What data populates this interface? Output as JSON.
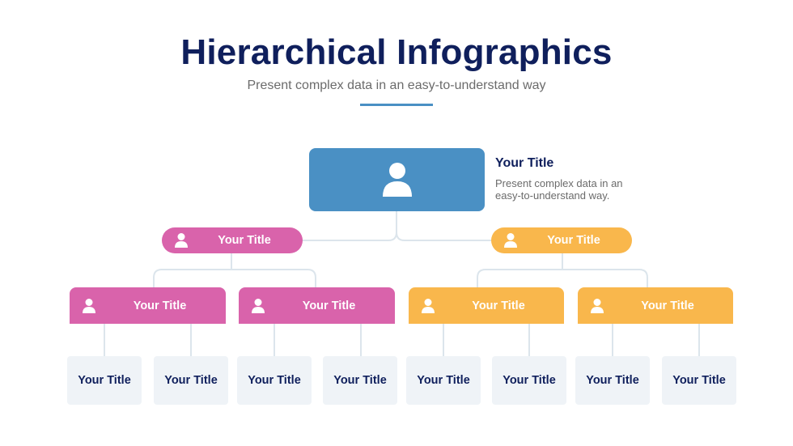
{
  "header": {
    "title": "Hierarchical Infographics",
    "subtitle": "Present complex data in an easy-to-understand way"
  },
  "colors": {
    "navy": "#0f1f5c",
    "blue": "#4a90c4",
    "pink": "#d963ab",
    "orange": "#f9b74c",
    "leaf_bg": "#eff3f7",
    "connector": "#dce5ec",
    "gray_text": "#6b6b6b"
  },
  "root": {
    "icon": "user-icon",
    "title": "Your Title",
    "description": "Present complex data in an easy-to-understand way."
  },
  "level2": [
    {
      "label": "Your Title",
      "icon": "user-icon",
      "color": "pink"
    },
    {
      "label": "Your Title",
      "icon": "user-icon",
      "color": "orange"
    }
  ],
  "level3": [
    {
      "label": "Your Title",
      "icon": "user-icon",
      "color": "pink"
    },
    {
      "label": "Your Title",
      "icon": "user-icon",
      "color": "pink"
    },
    {
      "label": "Your Title",
      "icon": "user-icon",
      "color": "orange"
    },
    {
      "label": "Your Title",
      "icon": "user-icon",
      "color": "orange"
    }
  ],
  "leaves": [
    {
      "label": "Your Title"
    },
    {
      "label": "Your Title"
    },
    {
      "label": "Your Title"
    },
    {
      "label": "Your Title"
    },
    {
      "label": "Your Title"
    },
    {
      "label": "Your Title"
    },
    {
      "label": "Your Title"
    },
    {
      "label": "Your Title"
    }
  ]
}
